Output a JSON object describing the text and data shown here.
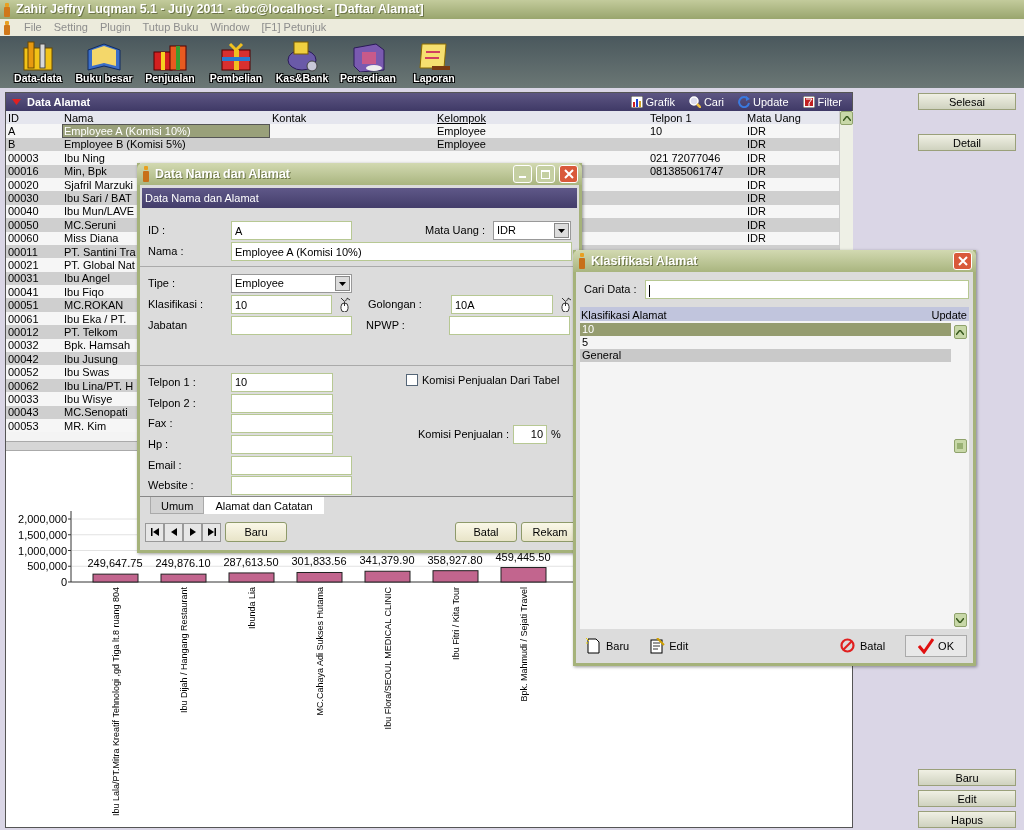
{
  "window": {
    "title": "Zahir Jeffry Luqman 5.1 - July 2011 - abc@localhost - [Daftar Alamat]"
  },
  "menu": [
    "File",
    "Setting",
    "Plugin",
    "Tutup Buku",
    "Window",
    "[F1] Petunjuk"
  ],
  "toolbar": [
    {
      "label": "Data-data"
    },
    {
      "label": "Buku besar"
    },
    {
      "label": "Penjualan"
    },
    {
      "label": "Pembelian"
    },
    {
      "label": "Kas&Bank"
    },
    {
      "label": "Persediaan"
    },
    {
      "label": "Laporan"
    }
  ],
  "panel": {
    "title": "Data Alamat",
    "actions": [
      {
        "label": "Grafik"
      },
      {
        "label": "Cari"
      },
      {
        "label": "Update"
      },
      {
        "label": "Filter"
      }
    ]
  },
  "table": {
    "columns": [
      {
        "label": "ID",
        "sorted": false
      },
      {
        "label": "Nama",
        "sorted": false
      },
      {
        "label": "Kontak",
        "sorted": false
      },
      {
        "label": "Kelompok",
        "sorted": true
      },
      {
        "label": "Telpon 1",
        "sorted": false
      },
      {
        "label": "Mata Uang",
        "sorted": false
      }
    ],
    "rows": [
      {
        "id": "A",
        "nama": "Employee A (Komisi 10%)",
        "kelompok": "Employee",
        "telpon_1": "10",
        "mata_uang": "IDR",
        "selected": true
      },
      {
        "id": "B",
        "nama": "Employee B (Komisi 5%)",
        "kelompok": "Employee",
        "mata_uang": "IDR",
        "selected": false
      },
      {
        "id": "00003",
        "nama": "Ibu Ning",
        "telpon_1": "021 72077046",
        "mata_uang": "IDR",
        "selected": false
      },
      {
        "id": "00016",
        "nama": "Min, Bpk",
        "telpon_1": "081385061747",
        "mata_uang": "IDR",
        "selected": false
      },
      {
        "id": "00020",
        "nama": "Sjafril Marzuki",
        "mata_uang": "IDR",
        "selected": false
      },
      {
        "id": "00030",
        "nama": "Ibu Sari / BAT",
        "mata_uang": "IDR",
        "selected": false
      },
      {
        "id": "00040",
        "nama": "Ibu Mun/LAVE",
        "mata_uang": "IDR",
        "selected": false
      },
      {
        "id": "00050",
        "nama": "MC.Seruni",
        "mata_uang": "IDR",
        "selected": false
      },
      {
        "id": "00060",
        "nama": "Miss Diana",
        "mata_uang": "IDR",
        "selected": false
      },
      {
        "id": "00011",
        "nama": "PT. Santini Tra",
        "selected": false
      },
      {
        "id": "00021",
        "nama": "PT. Global Nat",
        "selected": false
      },
      {
        "id": "00031",
        "nama": "Ibu Angel",
        "selected": false
      },
      {
        "id": "00041",
        "nama": "Ibu Fiqo",
        "selected": false
      },
      {
        "id": "00051",
        "nama": "MC.ROKAN",
        "selected": false
      },
      {
        "id": "00061",
        "nama": "Ibu Eka / PT.",
        "selected": false
      },
      {
        "id": "00012",
        "nama": "PT. Telkom",
        "selected": false
      },
      {
        "id": "00032",
        "nama": "Bpk. Hamsah",
        "selected": false
      },
      {
        "id": "00042",
        "nama": "Ibu Jusung",
        "selected": false
      },
      {
        "id": "00052",
        "nama": "Ibu Swas",
        "selected": false
      },
      {
        "id": "00062",
        "nama": "Ibu Lina/PT. H",
        "selected": false
      },
      {
        "id": "00033",
        "nama": "Ibu Wisye",
        "selected": false
      },
      {
        "id": "00043",
        "nama": "MC.Senopati",
        "selected": false
      },
      {
        "id": "00053",
        "nama": "MR. Kim",
        "selected": false
      }
    ]
  },
  "chart": {
    "chart_data": {
      "type": "bar",
      "categories": [
        "Ibu Lala/PT.Mitra Kreatif Tehnologi ,gd Tiga lt.8 ruang 804",
        "Ibu Dijah / Hangang Restaurant",
        "Ibunda Lia",
        "MC.Cahaya Adi Sukses Hutama",
        "Ibu Flora/SEOUL MEDICAL CLINIC",
        "Ibu Fitri / Kita Tour",
        "Bpk. Mahmudi / Sejati Travel"
      ],
      "series": [
        {
          "color": "#c2658e",
          "values": [
            249647.75,
            249876.1,
            287613.5,
            301833.56,
            341379.9,
            358927.8,
            459445.5
          ]
        }
      ],
      "grid": true,
      "ylim": [
        0,
        2000000
      ],
      "yticks": [
        {
          "value": 0,
          "label": "0"
        },
        {
          "value": 500000,
          "label": "500,000"
        },
        {
          "value": 1000000,
          "label": "1,000,000"
        },
        {
          "value": 1500000,
          "label": "1,500,000"
        },
        {
          "value": 2000000,
          "label": "2,000,000"
        }
      ],
      "value_labels": [
        "249,647.75",
        "249,876.10",
        "287,613.50",
        "301,833.56",
        "341,379.90",
        "358,927.80",
        "459,445.50"
      ]
    }
  },
  "side_buttons": {
    "top": [
      "Selesai",
      "Detail"
    ],
    "bottom": [
      "Baru",
      "Edit",
      "Hapus"
    ]
  },
  "dialog_address": {
    "title": "Data Nama dan Alamat",
    "header": "Data Nama dan Alamat",
    "form": {
      "id": {
        "label": "ID :",
        "value": "A"
      },
      "mata_uang": {
        "label": "Mata Uang :",
        "value": "IDR"
      },
      "nama": {
        "label": "Nama :",
        "value": "Employee A (Komisi 10%)"
      },
      "tipe": {
        "label": "Tipe :",
        "value": "Employee"
      },
      "klasifikasi": {
        "label": "Klasifikasi :",
        "value": "10"
      },
      "golongan": {
        "label": "Golongan :",
        "value": "10A"
      },
      "jabatan": {
        "label": "Jabatan"
      },
      "npwp": {
        "label": "NPWP :"
      },
      "telpon_1": {
        "label": "Telpon 1 :",
        "value": "10"
      },
      "telpon_2": {
        "label": "Telpon 2 :"
      },
      "fax": {
        "label": "Fax :"
      },
      "hp": {
        "label": "Hp :"
      },
      "email": {
        "label": "Email :"
      },
      "website": {
        "label": "Website :"
      },
      "komisi_dari_tabel": {
        "label": "Komisi Penjualan Dari Tabel",
        "checked": false
      },
      "komisi": {
        "label": "Komisi Penjualan :",
        "value": "10",
        "unit": "%"
      }
    },
    "tabs": [
      {
        "label": "Umum",
        "selected": false
      },
      {
        "label": "Alamat dan Catatan",
        "selected": true
      }
    ],
    "buttons": {
      "new": "Baru",
      "cancel": "Batal",
      "save": "Rekam"
    }
  },
  "dialog_klasifikasi": {
    "title": "Klasifikasi Alamat",
    "search": {
      "label": "Cari Data :"
    },
    "columns": [
      "Klasifikasi Alamat",
      "Update"
    ],
    "items": [
      {
        "label": "10",
        "selected": true
      },
      {
        "label": "5",
        "selected": false
      },
      {
        "label": "General",
        "selected": false
      }
    ],
    "buttons": [
      {
        "label": "Baru"
      },
      {
        "label": "Edit"
      },
      {
        "label": "Batal"
      },
      {
        "label": "OK"
      }
    ]
  }
}
